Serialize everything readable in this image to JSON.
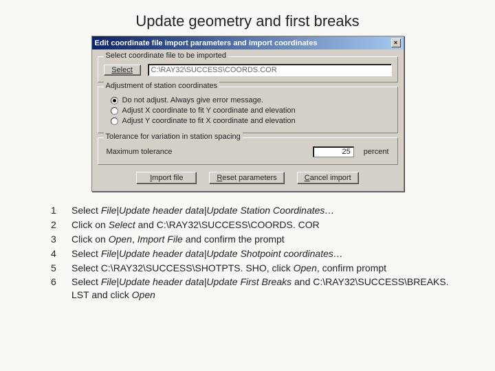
{
  "title": "Update geometry and first breaks",
  "dialog": {
    "caption": "Edit coordinate file import parameters and import coordinates",
    "group_select": {
      "label": "Select coordinate file to be imported",
      "select_btn": "Select",
      "path": "C:\\RAY32\\SUCCESS\\COORDS.COR"
    },
    "group_adjust": {
      "label": "Adjustment of station coordinates",
      "opt1": "Do not adjust. Always give error message.",
      "opt2": "Adjust X coordinate to fit Y coordinate and elevation",
      "opt3": "Adjust Y coordinate to fit X coordinate and elevation"
    },
    "group_tol": {
      "label": "Tolerance for variation in station spacing",
      "maxlabel": "Maximum tolerance",
      "value": "25",
      "unit": "percent"
    },
    "buttons": {
      "import_pre": "I",
      "import_rest": "mport file",
      "reset_pre": "R",
      "reset_rest": "eset parameters",
      "cancel_pre": "C",
      "cancel_rest": "ancel import"
    }
  },
  "steps": {
    "n1": "1",
    "s1a": "Select ",
    "s1b": "File|Update header data|Update Station Coordinates…",
    "n2": "2",
    "s2a": "Click on ",
    "s2b": "Select",
    "s2c": " and C:\\RAY32\\SUCCESS\\COORDS. COR",
    "n3": "3",
    "s3a": "Click on ",
    "s3b": "Open",
    "s3c": ", ",
    "s3d": "Import File",
    "s3e": " and confirm the prompt",
    "n4": "4",
    "s4a": "Select ",
    "s4b": "File|Update header data|Update Shotpoint coordinates…",
    "n5": "5",
    "s5a": "Select C:\\RAY32\\SUCCESS\\SHOTPTS. SHO, click ",
    "s5b": "Open",
    "s5c": ", confirm prompt",
    "n6": "6",
    "s6a": "Select ",
    "s6b": "File|Update header data|Update First Breaks",
    "s6c": " and C:\\RAY32\\SUCCESS\\BREAKS. LST and click ",
    "s6d": "Open"
  }
}
